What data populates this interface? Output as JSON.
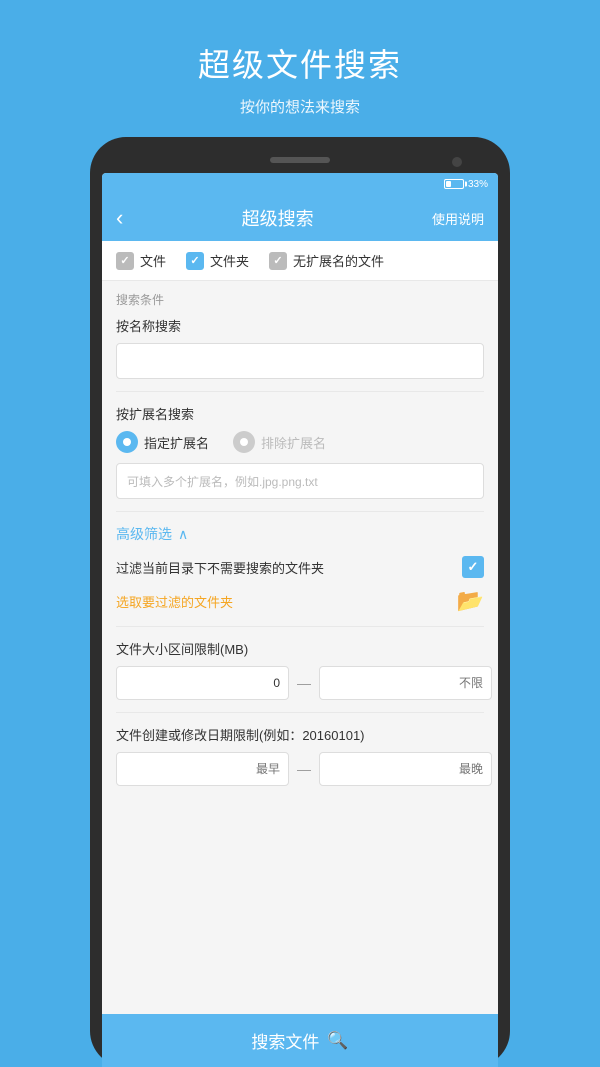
{
  "app": {
    "title": "超级文件搜索",
    "subtitle": "按你的想法来搜索"
  },
  "statusBar": {
    "battery": "33%"
  },
  "header": {
    "back_icon": "‹",
    "title": "超级搜索",
    "help_label": "使用说明"
  },
  "fileTypes": [
    {
      "label": "文件",
      "checked": "gray"
    },
    {
      "label": "文件夹",
      "checked": "blue"
    },
    {
      "label": "无扩展名的文件",
      "checked": "gray"
    }
  ],
  "searchConditions": {
    "section_label": "搜索条件",
    "byName": {
      "label": "按名称搜索",
      "placeholder": ""
    },
    "byExt": {
      "label": "按扩展名搜索",
      "radio1": "指定扩展名",
      "radio2": "排除扩展名",
      "placeholder": "可填入多个扩展名，例如.jpg.png.txt"
    }
  },
  "advanced": {
    "label": "高级筛选",
    "chevron": "∧",
    "filterFolderLabel": "过滤当前目录下不需要搜索的文件夹",
    "selectFolderText": "选取要过滤的文件夹",
    "sizeLabel": "文件大小区间限制(MB)",
    "sizeFrom": "0",
    "sizeTo_placeholder": "不限",
    "dateLabel": "文件创建或修改日期限制(例如：20160101)",
    "dateFrom_placeholder": "最早",
    "dateTo_placeholder": "最晚"
  },
  "searchButton": {
    "label": "搜索文件",
    "icon": "🔍"
  }
}
